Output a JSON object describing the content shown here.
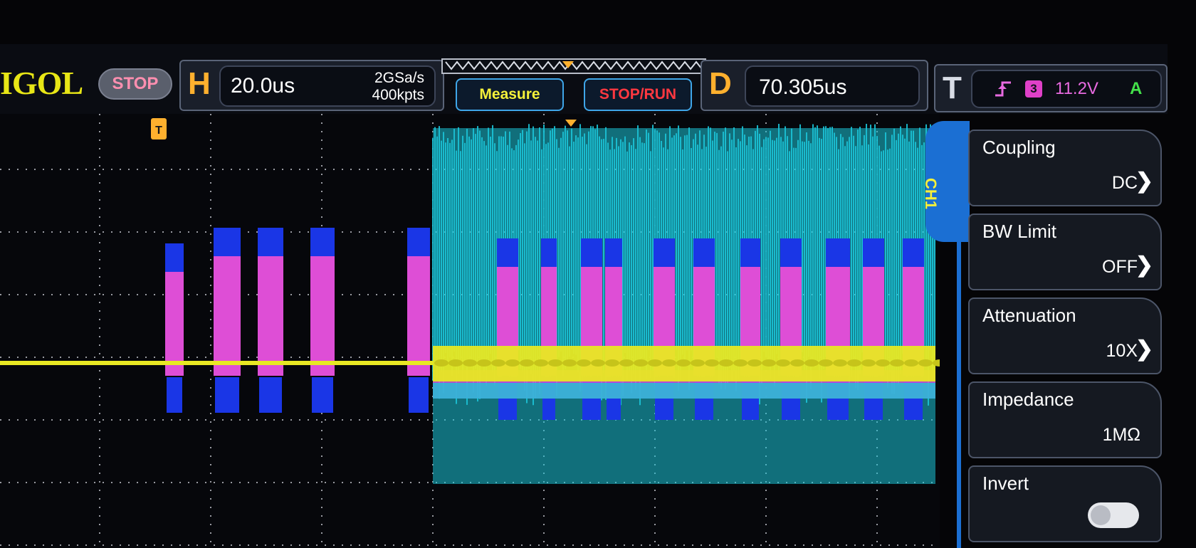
{
  "header": {
    "brand": "IGOL",
    "run_state": "STOP",
    "horizontal": {
      "key": "H",
      "timebase": "20.0us",
      "sample_rate": "2GSa/s",
      "memory_depth": "400kpts"
    },
    "buttons": {
      "measure": "Measure",
      "stop_run": "STOP/RUN"
    },
    "delay": {
      "key": "D",
      "value": "70.305us"
    },
    "trigger": {
      "key": "T",
      "edge_icon": "rising-edge-icon",
      "source": "3",
      "level": "11.2V",
      "status": "A"
    }
  },
  "trigger_marker": "T",
  "channel_tab": "CH1",
  "menu": {
    "items": [
      {
        "label": "Coupling",
        "value": "DC"
      },
      {
        "label": "BW Limit",
        "value": "OFF"
      },
      {
        "label": "Attenuation",
        "value": "10X"
      },
      {
        "label": "Impedance",
        "value": "1MΩ"
      },
      {
        "label": "Invert",
        "toggle": false
      }
    ]
  },
  "colors": {
    "ch1": "#e8e823",
    "ch2": "#1cc4d8",
    "ch3": "#de4ed6",
    "ch4": "#1a36e6",
    "accent": "#1b6fd3"
  }
}
